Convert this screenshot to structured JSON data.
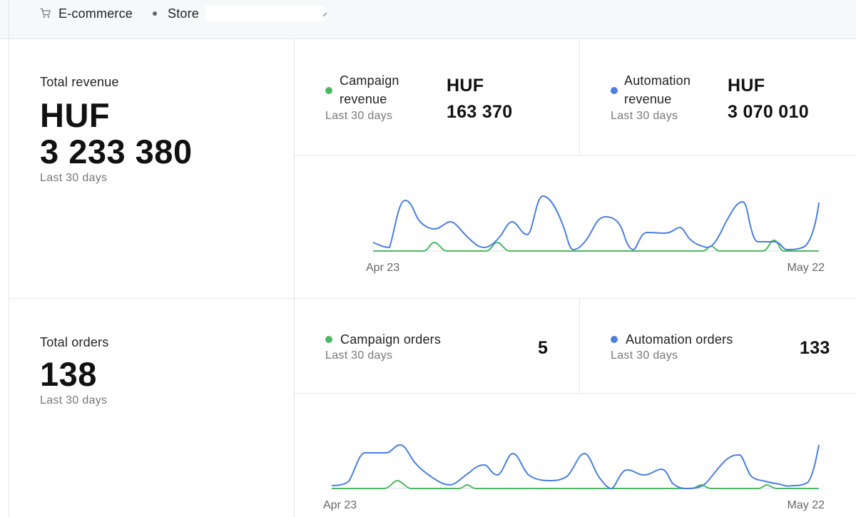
{
  "header": {
    "section": "E-commerce",
    "store_label": "Store"
  },
  "colors": {
    "campaign": "#4cb863",
    "automation": "#4a7fe0"
  },
  "revenue": {
    "total_label": "Total revenue",
    "total_currency": "HUF",
    "total_value": "3 233 380",
    "period": "Last 30 days",
    "campaign": {
      "label": "Campaign revenue",
      "currency": "HUF",
      "value": "163 370",
      "period": "Last 30 days"
    },
    "automation": {
      "label": "Automation revenue",
      "currency": "HUF",
      "value": "3 070 010",
      "period": "Last 30 days"
    },
    "chart": {
      "start_label": "Apr 23",
      "end_label": "May 22"
    }
  },
  "orders": {
    "total_label": "Total orders",
    "total_value": "138",
    "period": "Last 30 days",
    "campaign": {
      "label": "Campaign orders",
      "value": "5",
      "period": "Last 30 days"
    },
    "automation": {
      "label": "Automation orders",
      "value": "133",
      "period": "Last 30 days"
    },
    "chart": {
      "start_label": "Apr 23",
      "end_label": "May 22"
    }
  }
}
